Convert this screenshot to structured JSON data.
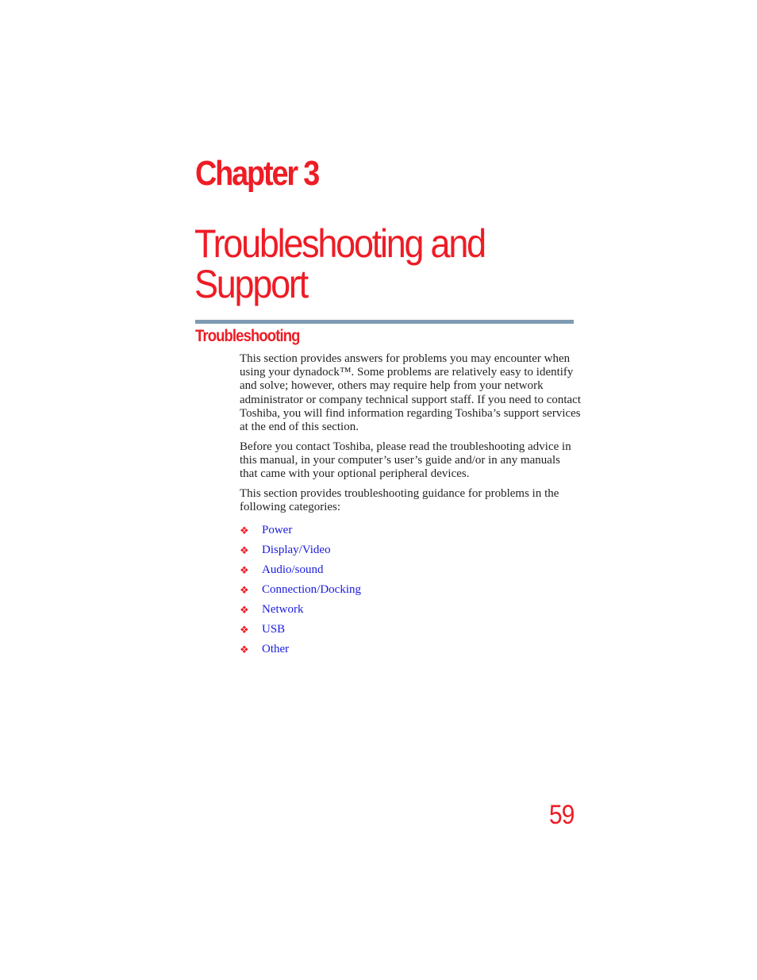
{
  "page": {
    "chapter_label": "Chapter 3",
    "chapter_title_line1": "Troubleshooting and",
    "chapter_title_line2": "Support",
    "section_heading": "Troubleshooting",
    "paragraphs": [
      "This section provides answers for problems you may encounter when using your dynadock™. Some problems are relatively easy to identify and solve; however, others may require help from your network administrator or company technical support staff. If you need to contact Toshiba, you will find information regarding Toshiba’s support services at the end of this section.",
      "Before you contact Toshiba, please read the troubleshooting advice in this manual, in your computer’s user’s guide and/or in any manuals that came with your optional peripheral devices.",
      "This section provides troubleshooting guidance for problems in the following categories:"
    ],
    "bullet_icon": "❖",
    "categories": [
      {
        "label": "Power"
      },
      {
        "label": "Display/Video"
      },
      {
        "label": "Audio/sound"
      },
      {
        "label": "Connection/Docking"
      },
      {
        "label": "Network"
      },
      {
        "label": "USB"
      },
      {
        "label": "Other"
      }
    ],
    "page_number": "59"
  },
  "colors": {
    "accent_red": "#ee1c25",
    "rule_blue_gray": "#7f9ab3",
    "link_blue": "#1a1adf",
    "body_text": "#231f20"
  }
}
